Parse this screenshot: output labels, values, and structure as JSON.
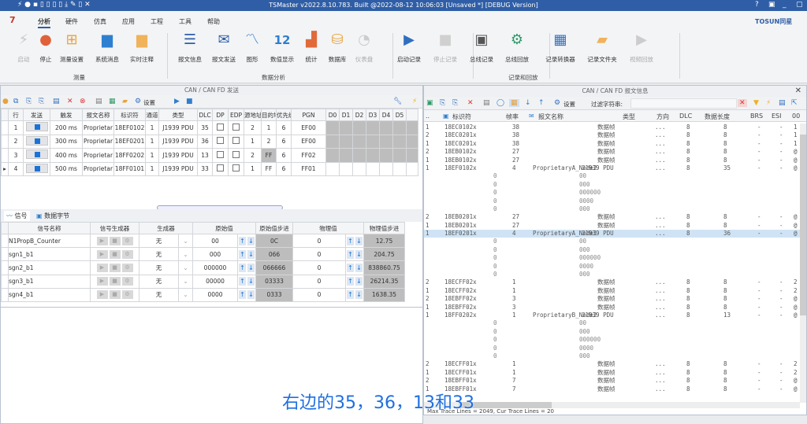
{
  "title": "TSMaster v2022.8.10.783. Built @2022-08-12 10:06:03 [Unsaved *] [DEBUG Version]",
  "window_controls": [
    "?",
    "▣",
    "_",
    "▢"
  ],
  "brand": "TOSUN同星",
  "logo": "7",
  "menu": [
    "分析",
    "硬件",
    "仿真",
    "应用",
    "工程",
    "工具",
    "帮助"
  ],
  "ribbon": {
    "groups": [
      {
        "label": "测量"
      },
      {
        "label": "数据分析"
      },
      {
        "label": "记录和回放"
      }
    ],
    "buttons": [
      {
        "label": "启动",
        "icon": "lightning-icon",
        "glyph": "⚡",
        "color": "#c8c8c8",
        "disabled": true
      },
      {
        "label": "停止",
        "icon": "stop-circle-icon",
        "glyph": "●",
        "color": "#e0603a"
      },
      {
        "label": "测量设置",
        "icon": "tree-icon",
        "glyph": "⊞",
        "color": "#e9a23b"
      },
      {
        "label": "系统消息",
        "icon": "message-icon",
        "glyph": "▆",
        "color": "#2f7fd0"
      },
      {
        "label": "实时注释",
        "icon": "note-icon",
        "glyph": "▆",
        "color": "#f0b25a"
      },
      {
        "label": "报文信息",
        "icon": "list-icon",
        "glyph": "☰",
        "color": "#2f5ea6"
      },
      {
        "label": "报文发送",
        "icon": "mail-send-icon",
        "glyph": "✉",
        "color": "#2f5ea6"
      },
      {
        "label": "图形",
        "icon": "line-chart-icon",
        "glyph": "〽",
        "color": "#2f7fd0"
      },
      {
        "label": "数值显示",
        "icon": "number-icon",
        "glyph": "12",
        "color": "#2f7fd0"
      },
      {
        "label": "统计",
        "icon": "bar-chart-icon",
        "glyph": "▟",
        "color": "#e06a3a"
      },
      {
        "label": "数据库",
        "icon": "database-icon",
        "glyph": "⛁",
        "color": "#e9a23b"
      },
      {
        "label": "仪表盘",
        "icon": "gauge-icon",
        "glyph": "◔",
        "color": "#cccccc",
        "disabled": true
      },
      {
        "label": "启动记录",
        "icon": "play-icon",
        "glyph": "▶",
        "color": "#2f6fc0"
      },
      {
        "label": "停止记录",
        "icon": "stop-icon",
        "glyph": "■",
        "color": "#d0d0d0",
        "disabled": true
      },
      {
        "label": "总线记录",
        "icon": "bus-record-icon",
        "glyph": "▣",
        "color": "#555"
      },
      {
        "label": "总线回放",
        "icon": "bus-replay-icon",
        "glyph": "⚙",
        "color": "#2e9a6a"
      },
      {
        "label": "记录转换器",
        "icon": "converter-icon",
        "glyph": "▦",
        "color": "#2f6fc0"
      },
      {
        "label": "记录文件夹",
        "icon": "folder-icon",
        "glyph": "▰",
        "color": "#f0b25a"
      },
      {
        "label": "视频回放",
        "icon": "video-play-icon",
        "glyph": "▶",
        "color": "#cccccc",
        "disabled": true
      }
    ]
  },
  "send_panel": {
    "title": "CAN / CAN FD 发送",
    "settings_label": "设置",
    "columns": [
      "行",
      "发送",
      "触发",
      "报文名称",
      "标识符",
      "通道",
      "类型",
      "DLC",
      "DP",
      "EDP",
      "源地址",
      "目的地",
      "优先级",
      "PGN",
      "D0",
      "D1",
      "D2",
      "D3",
      "D4",
      "D5"
    ],
    "rows": [
      {
        "row": "1",
        "trigger": "200 ms",
        "name": "Proprietar",
        "id": "18EF0102",
        "ch": "1",
        "type": "J1939 PDU",
        "dlc": "35",
        "src": "2",
        "dst": "1",
        "prio": "6",
        "pgn": "EF00"
      },
      {
        "row": "2",
        "trigger": "300 ms",
        "name": "Proprietar",
        "id": "18EF0201",
        "ch": "1",
        "type": "J1939 PDU",
        "dlc": "36",
        "src": "1",
        "dst": "2",
        "prio": "6",
        "pgn": "EF00"
      },
      {
        "row": "3",
        "trigger": "400 ms",
        "name": "Proprietar",
        "id": "18FF0202",
        "ch": "1",
        "type": "J1939 PDU",
        "dlc": "13",
        "src": "2",
        "dst": "FF",
        "prio": "6",
        "pgn": "FF02"
      },
      {
        "row": "4",
        "trigger": "500 ms",
        "name": "Proprietar",
        "id": "18FF0101",
        "ch": "1",
        "type": "J1939 PDU",
        "dlc": "33",
        "src": "1",
        "dst": "FF",
        "prio": "6",
        "pgn": "FF01"
      }
    ]
  },
  "signal_panel": {
    "tabs": [
      "信号",
      "数据字节"
    ],
    "columns": [
      "信号名称",
      "信号生成器",
      "生成器",
      "原始值",
      "原始值步进",
      "物理值",
      "物理值步进"
    ],
    "rows": [
      {
        "name": "N1PropB_Counter",
        "gen": "无",
        "raw": "00",
        "raw_step": "0C",
        "phys": "0",
        "phys_step": "12.75"
      },
      {
        "name": "sgn1_b1",
        "gen": "无",
        "raw": "000",
        "raw_step": "066",
        "phys": "0",
        "phys_step": "204.75"
      },
      {
        "name": "sgn2_b1",
        "gen": "无",
        "raw": "000000",
        "raw_step": "066666",
        "phys": "0",
        "phys_step": "838860.75"
      },
      {
        "name": "sgn3_b1",
        "gen": "无",
        "raw": "00000",
        "raw_step": "03333",
        "phys": "0",
        "phys_step": "26214.35"
      },
      {
        "name": "sgn4_b1",
        "gen": "无",
        "raw": "0000",
        "raw_step": "0333",
        "phys": "0",
        "phys_step": "1638.35"
      }
    ]
  },
  "trace_panel": {
    "title": "CAN / CAN FD 报文信息",
    "settings_label": "设置",
    "filter_label": "过滤字符串:",
    "columns": [
      "标识符",
      "帧率",
      "报文名称",
      "类型",
      "方向",
      "DLC",
      "数据长度",
      "BRS",
      "ESI",
      "00"
    ],
    "rows": [
      {
        "k": "m",
        "ch": "1",
        "id": "18EC0102x",
        "rate": "38",
        "name": "",
        "type": "数据帧",
        "dir": "...",
        "dlc": "8",
        "len": "8",
        "brs": "-",
        "esi": "-",
        "d": "1"
      },
      {
        "k": "m",
        "ch": "2",
        "id": "18EC0201x",
        "rate": "38",
        "name": "",
        "type": "数据帧",
        "dir": "...",
        "dlc": "8",
        "len": "8",
        "brs": "-",
        "esi": "-",
        "d": "1"
      },
      {
        "k": "m",
        "ch": "1",
        "id": "18EC0201x",
        "rate": "38",
        "name": "",
        "type": "数据帧",
        "dir": "...",
        "dlc": "8",
        "len": "8",
        "brs": "-",
        "esi": "-",
        "d": "1"
      },
      {
        "k": "m",
        "ch": "2",
        "id": "18EB0102x",
        "rate": "27",
        "name": "",
        "type": "数据帧",
        "dir": "...",
        "dlc": "8",
        "len": "8",
        "brs": "-",
        "esi": "-",
        "d": "@"
      },
      {
        "k": "m",
        "ch": "1",
        "id": "18EB0102x",
        "rate": "27",
        "name": "",
        "type": "数据帧",
        "dir": "...",
        "dlc": "8",
        "len": "8",
        "brs": "-",
        "esi": "-",
        "d": "@"
      },
      {
        "k": "m",
        "ch": "1",
        "id": "18EF0102x",
        "rate": "4",
        "name": "ProprietaryA_Node2",
        "type": "J1939 PDU",
        "dir": "...",
        "dlc": "8",
        "len": "35",
        "brs": "-",
        "esi": "-",
        "d": "@"
      },
      {
        "k": "s",
        "v": "0",
        "raw": "00"
      },
      {
        "k": "s",
        "v": "0",
        "raw": "000"
      },
      {
        "k": "s",
        "v": "0",
        "raw": "000000"
      },
      {
        "k": "s",
        "v": "0",
        "raw": "0000"
      },
      {
        "k": "s",
        "v": "0",
        "raw": "000"
      },
      {
        "k": "m",
        "ch": "2",
        "id": "18EB0201x",
        "rate": "27",
        "name": "",
        "type": "数据帧",
        "dir": "...",
        "dlc": "8",
        "len": "8",
        "brs": "-",
        "esi": "-",
        "d": "@"
      },
      {
        "k": "m",
        "ch": "1",
        "id": "18EB0201x",
        "rate": "27",
        "name": "",
        "type": "数据帧",
        "dir": "...",
        "dlc": "8",
        "len": "8",
        "brs": "-",
        "esi": "-",
        "d": "@"
      },
      {
        "k": "m",
        "sel": true,
        "ch": "1",
        "id": "18EF0201x",
        "rate": "4",
        "name": "ProprietaryA_Node1",
        "type": "J1939 PDU",
        "dir": "...",
        "dlc": "8",
        "len": "36",
        "brs": "-",
        "esi": "-",
        "d": "@"
      },
      {
        "k": "s",
        "v": "0",
        "raw": "00"
      },
      {
        "k": "s",
        "v": "0",
        "raw": "000"
      },
      {
        "k": "s",
        "v": "0",
        "raw": "000000"
      },
      {
        "k": "s",
        "v": "0",
        "raw": "0000"
      },
      {
        "k": "s",
        "v": "0",
        "raw": "000"
      },
      {
        "k": "m",
        "ch": "2",
        "id": "18ECFF02x",
        "rate": "1",
        "name": "",
        "type": "数据帧",
        "dir": "...",
        "dlc": "8",
        "len": "8",
        "brs": "-",
        "esi": "-",
        "d": "2"
      },
      {
        "k": "m",
        "ch": "1",
        "id": "18ECFF02x",
        "rate": "1",
        "name": "",
        "type": "数据帧",
        "dir": "...",
        "dlc": "8",
        "len": "8",
        "brs": "-",
        "esi": "-",
        "d": "2"
      },
      {
        "k": "m",
        "ch": "2",
        "id": "18EBFF02x",
        "rate": "3",
        "name": "",
        "type": "数据帧",
        "dir": "...",
        "dlc": "8",
        "len": "8",
        "brs": "-",
        "esi": "-",
        "d": "@"
      },
      {
        "k": "m",
        "ch": "1",
        "id": "18EBFF02x",
        "rate": "3",
        "name": "",
        "type": "数据帧",
        "dir": "...",
        "dlc": "8",
        "len": "8",
        "brs": "-",
        "esi": "-",
        "d": "@"
      },
      {
        "k": "m",
        "ch": "1",
        "id": "18FF0202x",
        "rate": "1",
        "name": "ProprietaryB_Node2",
        "type": "J1939 PDU",
        "dir": "...",
        "dlc": "8",
        "len": "13",
        "brs": "-",
        "esi": "-",
        "d": "@"
      },
      {
        "k": "s",
        "v": "0",
        "raw": "00"
      },
      {
        "k": "s",
        "v": "0",
        "raw": "000"
      },
      {
        "k": "s",
        "v": "0",
        "raw": "000000"
      },
      {
        "k": "s",
        "v": "0",
        "raw": "0000"
      },
      {
        "k": "s",
        "v": "0",
        "raw": "000"
      },
      {
        "k": "m",
        "ch": "2",
        "id": "18ECFF01x",
        "rate": "1",
        "name": "",
        "type": "数据帧",
        "dir": "...",
        "dlc": "8",
        "len": "8",
        "brs": "-",
        "esi": "-",
        "d": "2"
      },
      {
        "k": "m",
        "ch": "1",
        "id": "18ECFF01x",
        "rate": "1",
        "name": "",
        "type": "数据帧",
        "dir": "...",
        "dlc": "8",
        "len": "8",
        "brs": "-",
        "esi": "-",
        "d": "2"
      },
      {
        "k": "m",
        "ch": "2",
        "id": "18EBFF01x",
        "rate": "7",
        "name": "",
        "type": "数据帧",
        "dir": "...",
        "dlc": "8",
        "len": "8",
        "brs": "-",
        "esi": "-",
        "d": "@"
      },
      {
        "k": "m",
        "ch": "1",
        "id": "18EBFF01x",
        "rate": "7",
        "name": "",
        "type": "数据帧",
        "dir": "...",
        "dlc": "8",
        "len": "8",
        "brs": "-",
        "esi": "-",
        "d": "@"
      }
    ],
    "status": "Max Trace Lines = 2049, Cur Trace Lines = 20"
  },
  "subtitle": "右边的35，36，13和33"
}
